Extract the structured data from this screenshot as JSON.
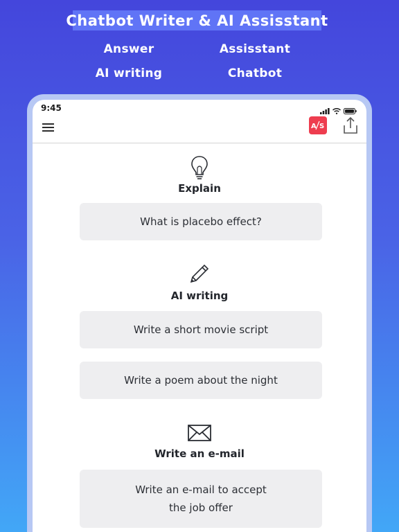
{
  "banner": {
    "title": "Chatbot Writer & AI Assisstant",
    "features": [
      "Answer",
      "Assisstant",
      "AI writing",
      "Chatbot"
    ]
  },
  "status_bar": {
    "time": "9:45"
  },
  "toolbar": {
    "menu_icon": "hamburger-menu-icon",
    "translate_icon_text": "A/S",
    "share_icon": "share-upload-icon",
    "accent_color": "#ee3d4f"
  },
  "sections": [
    {
      "icon": "lightbulb-icon",
      "title": "Explain",
      "prompts": [
        "What is placebo effect?"
      ]
    },
    {
      "icon": "pencil-icon",
      "title": "AI writing",
      "prompts": [
        "Write a short movie script",
        "Write a poem about the night"
      ]
    },
    {
      "icon": "envelope-icon",
      "title": "Write an e-mail",
      "prompts": [
        "Write an e-mail to accept the job offer"
      ]
    }
  ]
}
